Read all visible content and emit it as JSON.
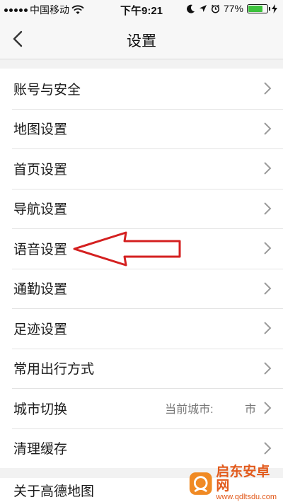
{
  "status_bar": {
    "carrier": "中国移动",
    "time": "下午9:21",
    "battery_percent": "77%",
    "battery_level": 0.77,
    "icons": [
      "signal-dots-icon",
      "wifi-icon",
      "moon-icon",
      "location-arrow-icon",
      "alarm-icon",
      "battery-icon",
      "charging-bolt-icon"
    ]
  },
  "nav": {
    "title": "设置",
    "back_icon": "chevron-left-icon"
  },
  "settings": {
    "items": [
      {
        "label": "账号与安全"
      },
      {
        "label": "地图设置"
      },
      {
        "label": "首页设置"
      },
      {
        "label": "导航设置"
      },
      {
        "label": "语音设置"
      },
      {
        "label": "通勤设置"
      },
      {
        "label": "足迹设置"
      },
      {
        "label": "常用出行方式"
      },
      {
        "label": "城市切换",
        "value": "当前城市:          市"
      },
      {
        "label": "清理缓存"
      }
    ],
    "about": {
      "label": "关于高德地图"
    }
  },
  "annotation": {
    "color": "#d42020"
  },
  "watermark": {
    "main": "启东安卓网",
    "sub": "www.qdltsdu.com",
    "color": "#e25a1c"
  },
  "colors": {
    "background": "#f2f2f2",
    "battery_fill": "#3dc23d"
  }
}
